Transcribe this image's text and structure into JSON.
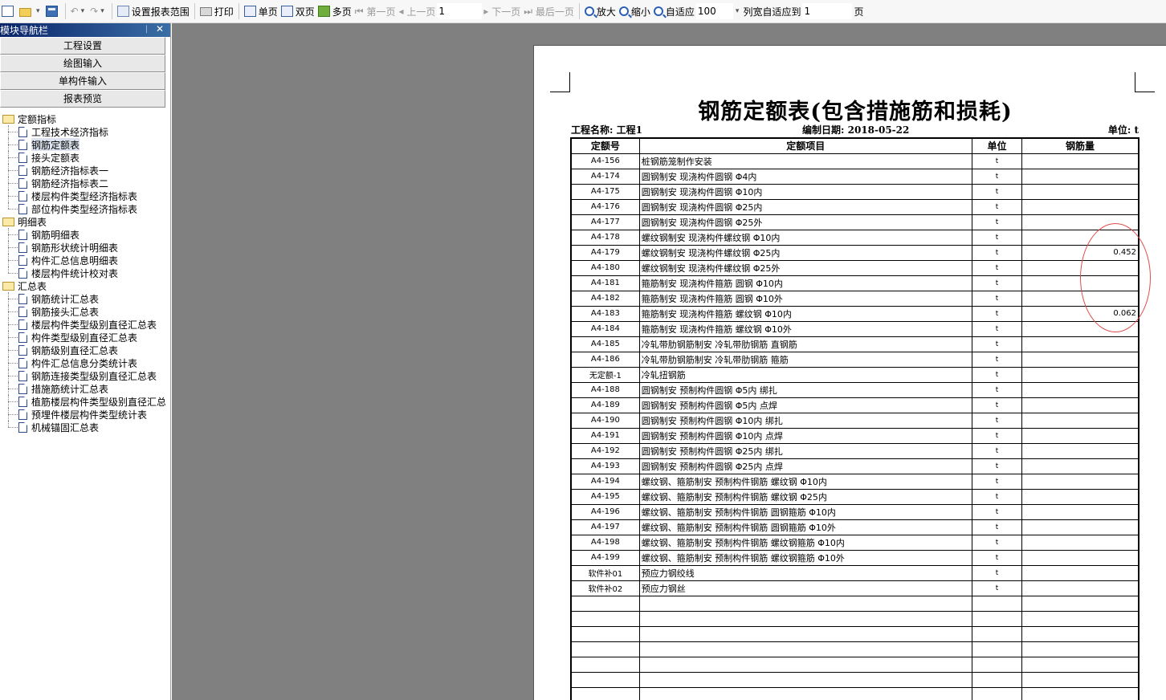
{
  "toolbar": {
    "set_range": "设置报表范围",
    "print": "打印",
    "single_page": "单页",
    "double_page": "双页",
    "multi_page": "多页",
    "first_page": "第一页",
    "prev_page": "上一页",
    "page_value": "1",
    "next_page": "下一页",
    "last_page": "最后一页",
    "zoom_in": "放大",
    "zoom_out": "缩小",
    "fit": "自适应",
    "zoom_value": "100",
    "col_fit": "列宽自适应到",
    "col_fit_value": "1",
    "page_suffix": "页"
  },
  "nav": {
    "title": "模块导航栏",
    "pin": "ᛁ",
    "close": "✕",
    "buttons": [
      "工程设置",
      "绘图输入",
      "单构件输入",
      "报表预览"
    ],
    "groups": [
      {
        "label": "定额指标",
        "items": [
          "工程技术经济指标",
          "钢筋定额表",
          "接头定额表",
          "钢筋经济指标表一",
          "钢筋经济指标表二",
          "楼层构件类型经济指标表",
          "部位构件类型经济指标表"
        ]
      },
      {
        "label": "明细表",
        "items": [
          "钢筋明细表",
          "钢筋形状统计明细表",
          "构件汇总信息明细表",
          "楼层构件统计校对表"
        ]
      },
      {
        "label": "汇总表",
        "items": [
          "钢筋统计汇总表",
          "钢筋接头汇总表",
          "楼层构件类型级别直径汇总表",
          "构件类型级别直径汇总表",
          "钢筋级别直径汇总表",
          "构件汇总信息分类统计表",
          "钢筋连接类型级别直径汇总表",
          "措施筋统计汇总表",
          "植筋楼层构件类型级别直径汇总表",
          "预埋件楼层构件类型统计表",
          "机械锚固汇总表"
        ]
      }
    ]
  },
  "report": {
    "title": "钢筋定额表(包含措施筋和损耗)",
    "project": "工程名称: 工程1",
    "date": "编制日期: 2018-05-22",
    "unit": "单位: t",
    "headers": [
      "定额号",
      "定额项目",
      "单位",
      "钢筋量"
    ],
    "rows": [
      [
        "A4-156",
        "桩钢筋笼制作安装",
        "t",
        ""
      ],
      [
        "A4-174",
        "圆钢制安 现浇构件圆钢 Φ4内",
        "t",
        ""
      ],
      [
        "A4-175",
        "圆钢制安 现浇构件圆钢 Φ10内",
        "t",
        ""
      ],
      [
        "A4-176",
        "圆钢制安 现浇构件圆钢 Φ25内",
        "t",
        ""
      ],
      [
        "A4-177",
        "圆钢制安 现浇构件圆钢 Φ25外",
        "t",
        ""
      ],
      [
        "A4-178",
        "螺纹钢制安 现浇构件螺纹钢 Φ10内",
        "t",
        ""
      ],
      [
        "A4-179",
        "螺纹钢制安 现浇构件螺纹钢 Φ25内",
        "t",
        "0.452"
      ],
      [
        "A4-180",
        "螺纹钢制安 现浇构件螺纹钢 Φ25外",
        "t",
        ""
      ],
      [
        "A4-181",
        "箍筋制安 现浇构件箍筋 圆钢 Φ10内",
        "t",
        ""
      ],
      [
        "A4-182",
        "箍筋制安 现浇构件箍筋 圆钢 Φ10外",
        "t",
        ""
      ],
      [
        "A4-183",
        "箍筋制安 现浇构件箍筋 螺纹钢 Φ10内",
        "t",
        "0.062"
      ],
      [
        "A4-184",
        "箍筋制安 现浇构件箍筋 螺纹钢 Φ10外",
        "t",
        ""
      ],
      [
        "A4-185",
        "冷轧带肋钢筋制安 冷轧带肋钢筋 直钢筋",
        "t",
        ""
      ],
      [
        "A4-186",
        "冷轧带肋钢筋制安 冷轧带肋钢筋 箍筋",
        "t",
        ""
      ],
      [
        "无定额-1",
        "冷轧扭钢筋",
        "t",
        ""
      ],
      [
        "A4-188",
        "圆钢制安 预制构件圆钢 Φ5内 绑扎",
        "t",
        ""
      ],
      [
        "A4-189",
        "圆钢制安 预制构件圆钢 Φ5内 点焊",
        "t",
        ""
      ],
      [
        "A4-190",
        "圆钢制安 预制构件圆钢 Φ10内 绑扎",
        "t",
        ""
      ],
      [
        "A4-191",
        "圆钢制安 预制构件圆钢 Φ10内 点焊",
        "t",
        ""
      ],
      [
        "A4-192",
        "圆钢制安 预制构件圆钢 Φ25内 绑扎",
        "t",
        ""
      ],
      [
        "A4-193",
        "圆钢制安 预制构件圆钢 Φ25内 点焊",
        "t",
        ""
      ],
      [
        "A4-194",
        "螺纹钢、箍筋制安 预制构件钢筋 螺纹钢 Φ10内",
        "t",
        ""
      ],
      [
        "A4-195",
        "螺纹钢、箍筋制安 预制构件钢筋 螺纹钢 Φ25内",
        "t",
        ""
      ],
      [
        "A4-196",
        "螺纹钢、箍筋制安 预制构件钢筋 圆钢箍筋 Φ10内",
        "t",
        ""
      ],
      [
        "A4-197",
        "螺纹钢、箍筋制安 预制构件钢筋 圆钢箍筋 Φ10外",
        "t",
        ""
      ],
      [
        "A4-198",
        "螺纹钢、箍筋制安 预制构件钢筋 螺纹钢箍筋 Φ10内",
        "t",
        ""
      ],
      [
        "A4-199",
        "螺纹钢、箍筋制安 预制构件钢筋 螺纹钢箍筋 Φ10外",
        "t",
        ""
      ],
      [
        "软件补01",
        "预应力钢绞线",
        "t",
        ""
      ],
      [
        "软件补02",
        "预应力钢丝",
        "t",
        ""
      ],
      [
        "",
        "",
        "",
        ""
      ],
      [
        "",
        "",
        "",
        ""
      ],
      [
        "",
        "",
        "",
        ""
      ],
      [
        "",
        "",
        "",
        ""
      ],
      [
        "",
        "",
        "",
        ""
      ],
      [
        "",
        "",
        "",
        ""
      ],
      [
        "",
        "",
        "",
        ""
      ]
    ]
  },
  "colors": {
    "nav_title": "#0a246a",
    "preview_bg": "#808080",
    "annotation": "#e04b4b"
  }
}
